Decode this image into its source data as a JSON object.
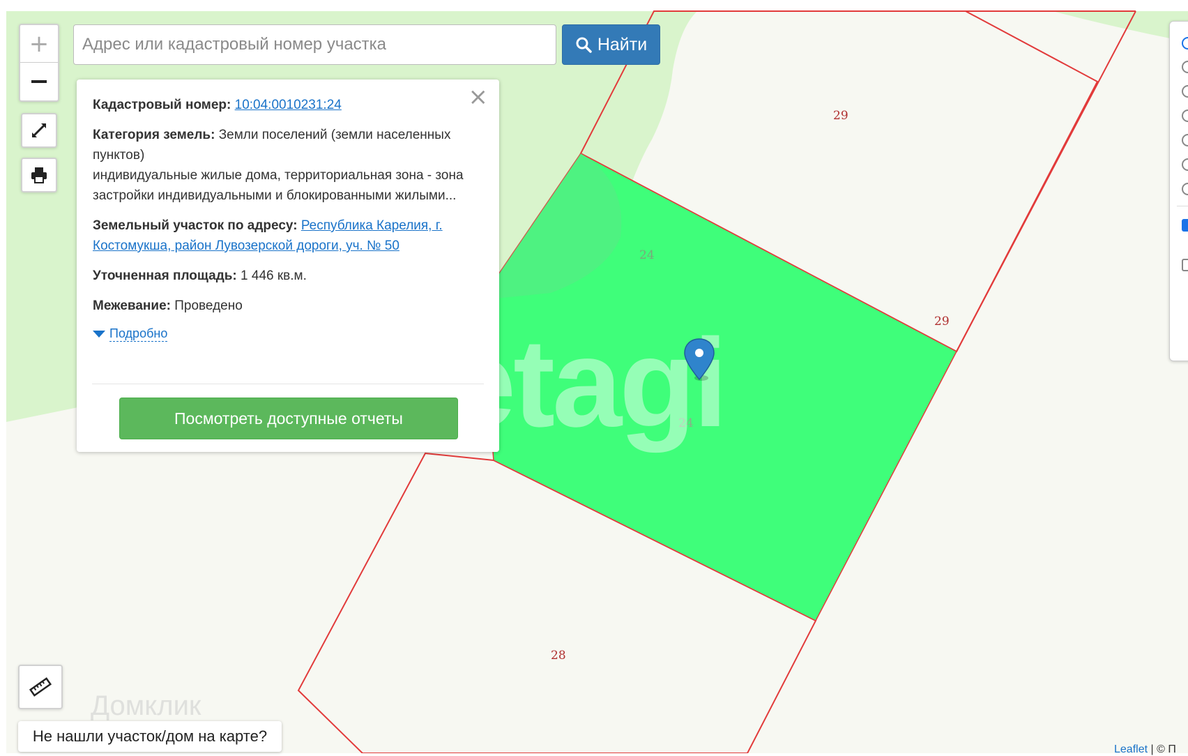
{
  "search": {
    "placeholder": "Адрес или кадастровый номер участка",
    "button_label": "Найти"
  },
  "map": {
    "plot_labels": [
      "29",
      "24",
      "29",
      "24",
      "28"
    ],
    "watermark": "etagi",
    "watermark_secondary": "Домклик",
    "selected_fill": "#3ffe7a",
    "boundary_color": "#e23b3b",
    "forest_color": "#d9f4cc",
    "background_color": "#f7f8f2"
  },
  "popup": {
    "cadastral_label": "Кадастровый номер:",
    "cadastral_value": "10:04:0010231:24",
    "category_label": "Категория земель:",
    "category_value": "Земли поселений (земли населенных пунктов)",
    "usage_text": "индивидуальные жилые дома, территориальная зона - зона застройки индивидуальными и блокированными жилыми...",
    "address_label": "Земельный участок по адресу:",
    "address_value": "Республика Карелия, г. Костомукша, район Лувозерской дороги, уч. № 50",
    "area_label": "Уточненная площадь:",
    "area_value": "1 446 кв.м.",
    "survey_label": "Межевание:",
    "survey_value": "Проведено",
    "more_link": "Подробно",
    "report_button": "Посмотреть доступные отчеты"
  },
  "not_found_button": "Не нашли участок/дом на карте?",
  "attribution": {
    "leaflet": "Leaflet",
    "rest": " | © П"
  }
}
